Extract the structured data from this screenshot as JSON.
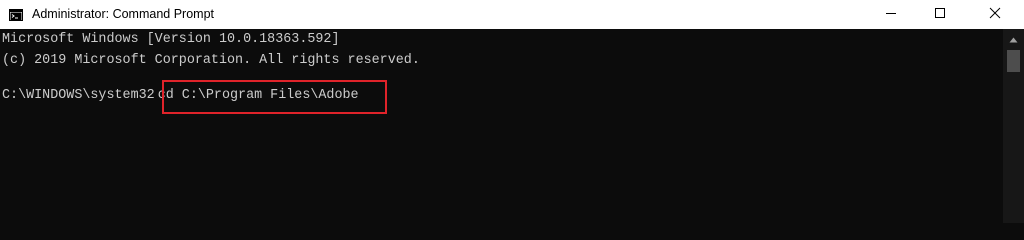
{
  "window": {
    "title": "Administrator: Command Prompt",
    "icons": {
      "app": "cmd-app-icon",
      "minimize": "minimize-icon",
      "maximize": "maximize-icon",
      "close": "close-icon",
      "scroll_up": "chevron-up-icon"
    }
  },
  "console": {
    "lines": [
      "Microsoft Windows [Version 10.0.18363.592]",
      "(c) 2019 Microsoft Corporation. All rights reserved."
    ],
    "prompt": "C:\\WINDOWS\\system32",
    "command": "cd C:\\Program Files\\Adobe"
  },
  "colors": {
    "background": "#0c0c0c",
    "text": "#cccccc",
    "highlight_border": "#e0232a",
    "titlebar": "#ffffff"
  }
}
